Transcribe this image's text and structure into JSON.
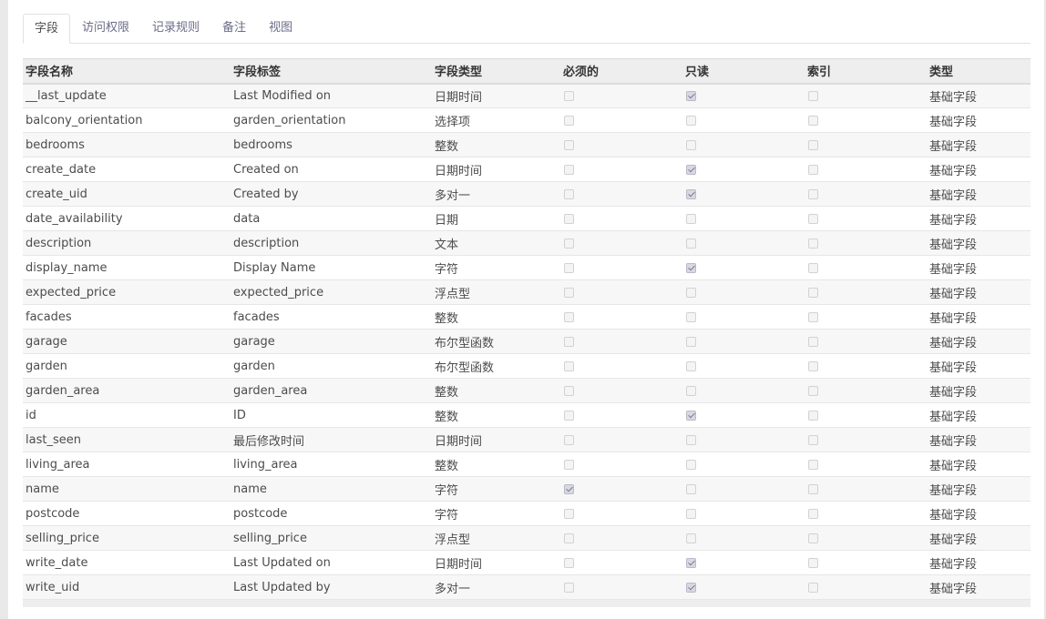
{
  "tabs": [
    {
      "label": "字段",
      "active": true
    },
    {
      "label": "访问权限",
      "active": false
    },
    {
      "label": "记录规则",
      "active": false
    },
    {
      "label": "备注",
      "active": false
    },
    {
      "label": "视图",
      "active": false
    }
  ],
  "columns": [
    "字段名称",
    "字段标签",
    "字段类型",
    "必须的",
    "只读",
    "索引",
    "类型"
  ],
  "rows": [
    {
      "name": "__last_update",
      "label": "Last Modified on",
      "ftype": "日期时间",
      "required": false,
      "readonly": true,
      "index": false,
      "kind": "基础字段"
    },
    {
      "name": "balcony_orientation",
      "label": "garden_orientation",
      "ftype": "选择项",
      "required": false,
      "readonly": false,
      "index": false,
      "kind": "基础字段"
    },
    {
      "name": "bedrooms",
      "label": "bedrooms",
      "ftype": "整数",
      "required": false,
      "readonly": false,
      "index": false,
      "kind": "基础字段"
    },
    {
      "name": "create_date",
      "label": "Created on",
      "ftype": "日期时间",
      "required": false,
      "readonly": true,
      "index": false,
      "kind": "基础字段"
    },
    {
      "name": "create_uid",
      "label": "Created by",
      "ftype": "多对一",
      "required": false,
      "readonly": true,
      "index": false,
      "kind": "基础字段"
    },
    {
      "name": "date_availability",
      "label": "data",
      "ftype": "日期",
      "required": false,
      "readonly": false,
      "index": false,
      "kind": "基础字段"
    },
    {
      "name": "description",
      "label": "description",
      "ftype": "文本",
      "required": false,
      "readonly": false,
      "index": false,
      "kind": "基础字段"
    },
    {
      "name": "display_name",
      "label": "Display Name",
      "ftype": "字符",
      "required": false,
      "readonly": true,
      "index": false,
      "kind": "基础字段"
    },
    {
      "name": "expected_price",
      "label": "expected_price",
      "ftype": "浮点型",
      "required": false,
      "readonly": false,
      "index": false,
      "kind": "基础字段"
    },
    {
      "name": "facades",
      "label": "facades",
      "ftype": "整数",
      "required": false,
      "readonly": false,
      "index": false,
      "kind": "基础字段"
    },
    {
      "name": "garage",
      "label": "garage",
      "ftype": "布尔型函数",
      "required": false,
      "readonly": false,
      "index": false,
      "kind": "基础字段"
    },
    {
      "name": "garden",
      "label": "garden",
      "ftype": "布尔型函数",
      "required": false,
      "readonly": false,
      "index": false,
      "kind": "基础字段"
    },
    {
      "name": "garden_area",
      "label": "garden_area",
      "ftype": "整数",
      "required": false,
      "readonly": false,
      "index": false,
      "kind": "基础字段"
    },
    {
      "name": "id",
      "label": "ID",
      "ftype": "整数",
      "required": false,
      "readonly": true,
      "index": false,
      "kind": "基础字段"
    },
    {
      "name": "last_seen",
      "label": "最后修改时间",
      "ftype": "日期时间",
      "required": false,
      "readonly": false,
      "index": false,
      "kind": "基础字段"
    },
    {
      "name": "living_area",
      "label": "living_area",
      "ftype": "整数",
      "required": false,
      "readonly": false,
      "index": false,
      "kind": "基础字段"
    },
    {
      "name": "name",
      "label": "name",
      "ftype": "字符",
      "required": true,
      "readonly": false,
      "index": false,
      "kind": "基础字段"
    },
    {
      "name": "postcode",
      "label": "postcode",
      "ftype": "字符",
      "required": false,
      "readonly": false,
      "index": false,
      "kind": "基础字段"
    },
    {
      "name": "selling_price",
      "label": "selling_price",
      "ftype": "浮点型",
      "required": false,
      "readonly": false,
      "index": false,
      "kind": "基础字段"
    },
    {
      "name": "write_date",
      "label": "Last Updated on",
      "ftype": "日期时间",
      "required": false,
      "readonly": true,
      "index": false,
      "kind": "基础字段"
    },
    {
      "name": "write_uid",
      "label": "Last Updated by",
      "ftype": "多对一",
      "required": false,
      "readonly": true,
      "index": false,
      "kind": "基础字段"
    }
  ]
}
